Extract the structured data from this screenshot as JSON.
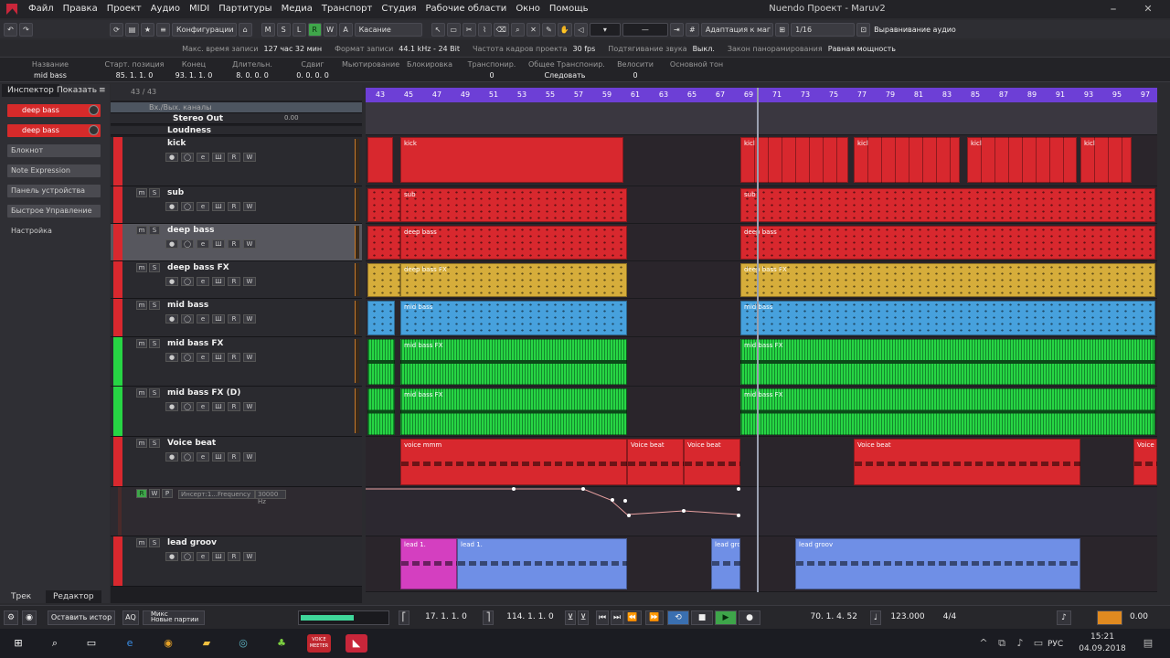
{
  "menu": {
    "items": [
      "Файл",
      "Правка",
      "Проект",
      "Аудио",
      "MIDI",
      "Партитуры",
      "Медиа",
      "Транспорт",
      "Студия",
      "Рабочие области",
      "Окно",
      "Помощь"
    ],
    "title": "Nuendo Проект - Maruv2"
  },
  "toolbar": {
    "config": "Конфигурации",
    "msrwa": [
      "M",
      "S",
      "L",
      "R",
      "W",
      "A"
    ],
    "touch": "Касание",
    "quantize": "Адаптация к маг",
    "grid": "1/16",
    "align": "Выравнивание аудио"
  },
  "info_bar": {
    "items": [
      {
        "label": "Макс. время записи",
        "value": "127 час 32 мин"
      },
      {
        "label": "Формат записи",
        "value": "44.1 kHz - 24 Bit"
      },
      {
        "label": "Частота кадров проекта",
        "value": "30 fps"
      },
      {
        "label": "Подтягивание звука",
        "value": "Выкл."
      },
      {
        "label": "Закон панорамирования",
        "value": "Равная мощность"
      }
    ]
  },
  "info_line": {
    "fields": [
      {
        "label": "Название",
        "value": "mid bass"
      },
      {
        "label": "Старт. позиция",
        "value": "85. 1. 1. 0"
      },
      {
        "label": "Конец",
        "value": "93. 1. 1. 0"
      },
      {
        "label": "Длительн.",
        "value": "8. 0. 0. 0"
      },
      {
        "label": "Сдвиг",
        "value": "0. 0. 0. 0"
      },
      {
        "label": "Мьютирование",
        "value": ""
      },
      {
        "label": "Блокировка",
        "value": ""
      },
      {
        "label": "Транспонир.",
        "value": "0"
      },
      {
        "label": "Общее Транспонир.",
        "value": "Следовать"
      },
      {
        "label": "Велосити",
        "value": "0"
      },
      {
        "label": "Основной тон",
        "value": ""
      }
    ]
  },
  "inspector": {
    "tabs": [
      "Инспектор",
      "Показать"
    ],
    "slot1": "deep bass",
    "slot2": "deep bass",
    "sections": [
      "Блокнот",
      "Note Expression",
      "Панель устройства",
      "Быстрое Управление",
      "Настройка"
    ],
    "bottom_tabs": [
      "Трек",
      "Редактор"
    ]
  },
  "tracklist": {
    "count": "43 / 43",
    "folder": "Вх./Вых. каналы",
    "stereo_out": "Stereo Out",
    "stereo_val": "0.00",
    "loudness": "Loudness",
    "insert": "Инсерт:1...Frequency",
    "insert_val": "30000 Hz",
    "tracks": [
      "kick",
      "sub",
      "deep bass",
      "deep bass FX",
      "mid bass",
      "mid bass FX",
      "mid bass FX (D)",
      "Voice beat",
      "",
      "lead groov"
    ]
  },
  "ruler": {
    "bars": [
      "43",
      "45",
      "47",
      "49",
      "51",
      "53",
      "55",
      "57",
      "59",
      "61",
      "63",
      "65",
      "67",
      "69",
      "71",
      "73",
      "75",
      "77",
      "79",
      "81",
      "83",
      "85",
      "87",
      "89",
      "91",
      "93",
      "95",
      "97"
    ]
  },
  "parts": {
    "kick": "kick",
    "kick_short": "kicl",
    "sub": "sub",
    "deep_bass": "deep bass",
    "deep_bass_fx": "deep bass FX",
    "mid_bass": "mid bass",
    "mid_bass_fx": "mid bass FX",
    "voice_mmm": "voice mmm",
    "voice_beat": "Voice beat",
    "voice_short": "Voice",
    "lead": "lead 1.",
    "lead_groov": "lead groov",
    "lead_short": "lead gro"
  },
  "transport": {
    "keep": "Оставить истор",
    "aq": "AQ",
    "mix": "Микс",
    "new_parts": "Новые партии",
    "left_loc": "17. 1. 1. 0",
    "right_loc": "114. 1. 1. 0",
    "position": "70. 1. 4. 52",
    "tempo": "123.000",
    "signature": "4/4",
    "level": "0.00"
  },
  "taskbar": {
    "lang": "РУС",
    "time": "15:21",
    "date": "04.09.2018",
    "voicemeeter": "VOICE MEETER"
  },
  "colors": {
    "red": "#d8282e",
    "yellow": "#d6ad3b",
    "blue": "#47a1dd",
    "green": "#27d544",
    "pink": "#d43fc0",
    "lilac": "#6f8fe6",
    "ruler": "#6d3fd6"
  }
}
